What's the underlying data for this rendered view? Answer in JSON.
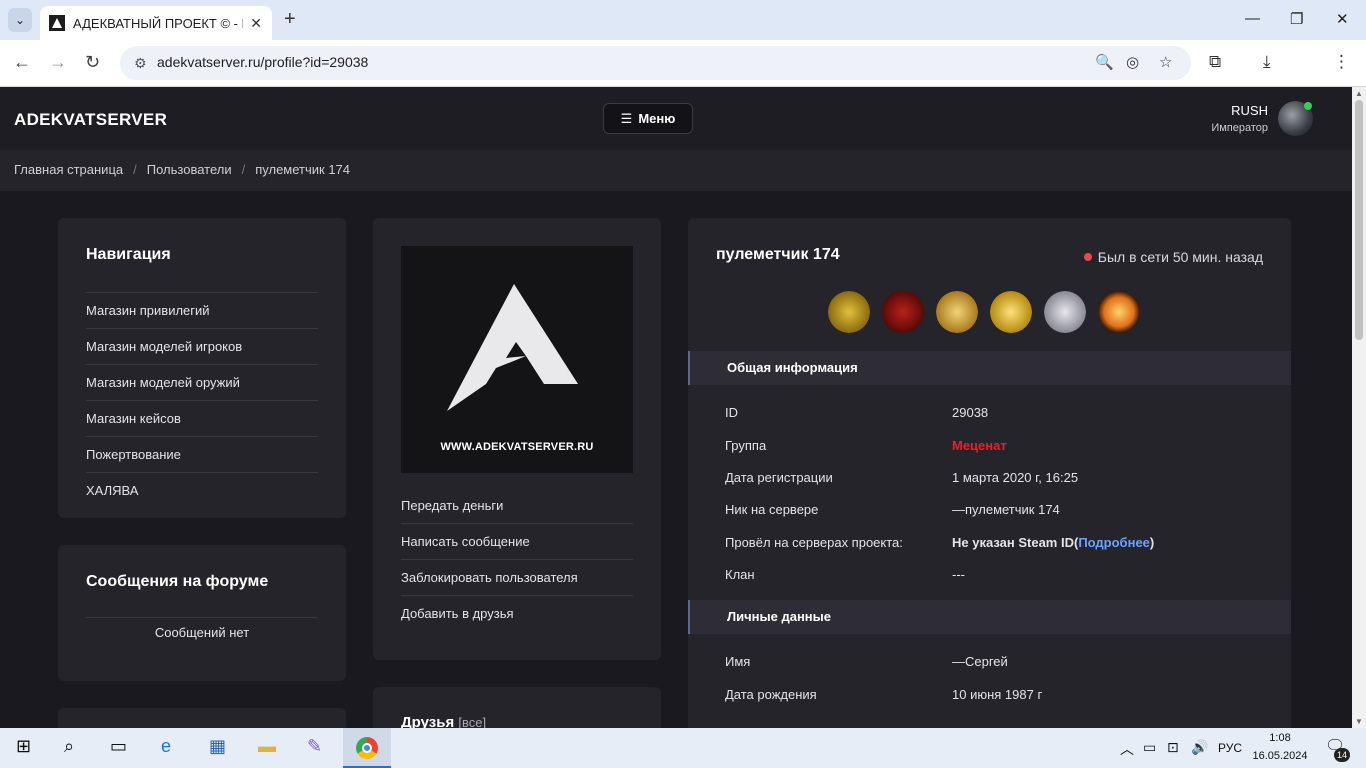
{
  "browser": {
    "tab_title": "АДЕКВАТНЫЙ ПРОЕКТ © - Пр",
    "url": "adekvatserver.ru/profile?id=29038",
    "new_tab": "+",
    "min": "—",
    "max": "❐",
    "close": "✕"
  },
  "site": {
    "logo": "ADEKVATSERVER",
    "menu_label": "Меню",
    "user_name": "RUSH",
    "user_role": "Император"
  },
  "breadcrumb": [
    "Главная страница",
    "Пользователи",
    "пулеметчик 174"
  ],
  "nav": {
    "title": "Навигация",
    "items": [
      "Магазин привилегий",
      "Магазин моделей игроков",
      "Магазин моделей оружий",
      "Магазин кейсов",
      "Пожертвование",
      "ХАЛЯВА"
    ]
  },
  "forum": {
    "title": "Сообщения на форуме",
    "empty": "Сообщений нет"
  },
  "avatar_card": {
    "banner_text": "WWW.ADEKVATSERVER.RU",
    "actions": [
      "Передать деньги",
      "Написать сообщение",
      "Заблокировать пользователя",
      "Добавить в друзья"
    ]
  },
  "friends": {
    "title": "Друзья",
    "all": "[все]"
  },
  "profile": {
    "name": "пулеметчик 174",
    "status": "Был в сети 50 мин. назад",
    "general_title": "Общая информация",
    "rows": [
      {
        "label": "ID",
        "value": "29038"
      },
      {
        "label": "Группа",
        "value": "Меценат"
      },
      {
        "label": "Дата регистрации",
        "value": "1 марта 2020 г, 16:25"
      },
      {
        "label": "Ник на сервере",
        "value": "—пулеметчик 174"
      },
      {
        "label": "Провёл на серверах проекта:",
        "value": "Не указан Steam ID(",
        "link": "Подробнее",
        "suffix": ")"
      },
      {
        "label": "Клан",
        "value": "---"
      }
    ],
    "personal_title": "Личные данные",
    "personal_rows": [
      {
        "label": "Имя",
        "value": "—Сергей"
      },
      {
        "label": "Дата рождения",
        "value": "10 июня 1987 г"
      }
    ]
  },
  "colors": {
    "group": "#e8202a",
    "link": "#6ea2ff",
    "offline": "#e84a4a"
  },
  "taskbar": {
    "lang": "РУС",
    "time": "1:08",
    "date": "16.05.2024",
    "notif_count": "14"
  }
}
